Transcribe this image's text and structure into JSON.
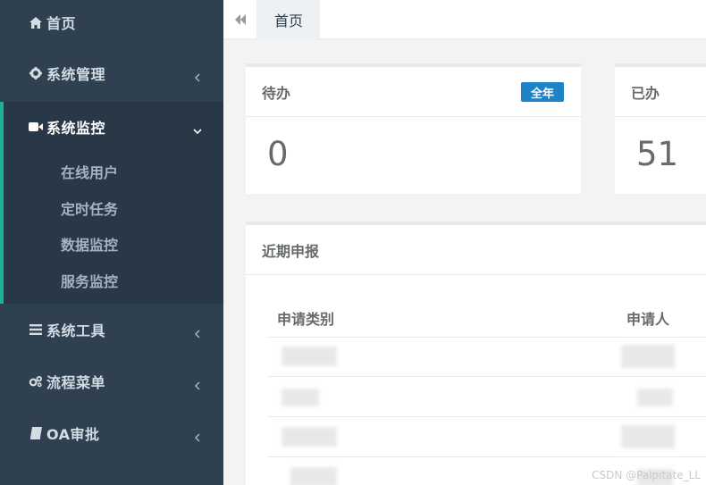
{
  "sidebar": {
    "items": [
      {
        "label": "首页",
        "icon": "home-icon"
      },
      {
        "label": "系统管理",
        "icon": "gear-icon"
      },
      {
        "label": "系统监控",
        "icon": "video-camera-icon",
        "submenu": [
          "在线用户",
          "定时任务",
          "数据监控",
          "服务监控"
        ]
      },
      {
        "label": "系统工具",
        "icon": "bars-icon"
      },
      {
        "label": "流程菜单",
        "icon": "gears-icon"
      },
      {
        "label": "OA审批",
        "icon": "book-icon"
      }
    ]
  },
  "topbar": {
    "tab_label": "首页"
  },
  "cards": {
    "pending": {
      "title": "待办",
      "badge": "全年",
      "value": "0"
    },
    "done": {
      "title": "已办",
      "value": "51"
    }
  },
  "recent": {
    "title": "近期申报",
    "columns": [
      "申请类别",
      "申请人"
    ]
  },
  "watermark": "CSDN @Palpitate_LL",
  "colors": {
    "sidebar_bg": "#2f4050",
    "active_bg": "#293846",
    "accent": "#1ab394",
    "badge": "#1c84c6"
  }
}
